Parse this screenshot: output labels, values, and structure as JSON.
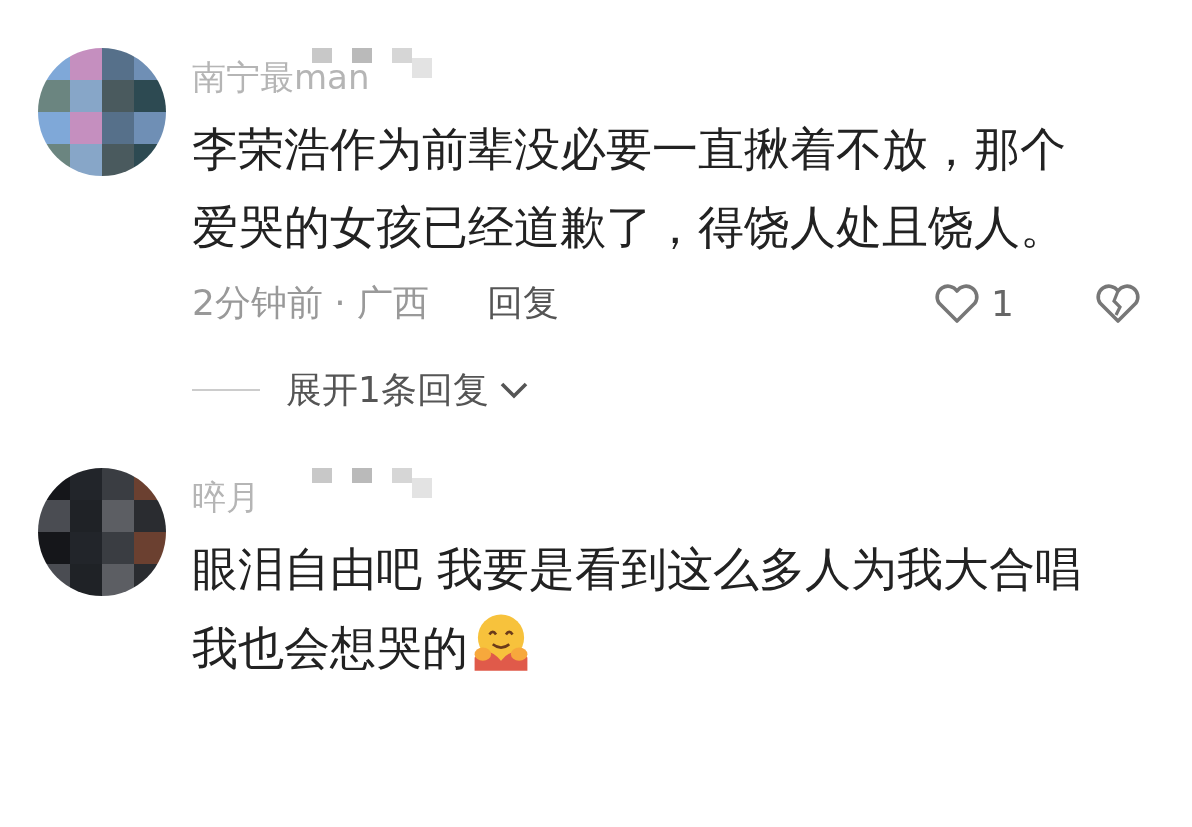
{
  "comments": [
    {
      "username": "南宁最man",
      "text": "李荣浩作为前辈没必要一直揪着不放，那个爱哭的女孩已经道歉了，得饶人处且饶人。",
      "time": "2分钟前 · 广西",
      "reply": "回复",
      "likes": "1",
      "expand": "展开1条回复"
    },
    {
      "username": "晬月",
      "text": "眼泪自由吧 我要是看到这么多人为我大合唱我也会想哭的",
      "emoji": true
    }
  ]
}
